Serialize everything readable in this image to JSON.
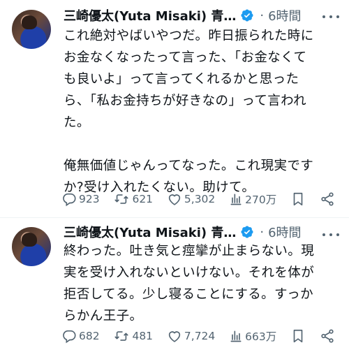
{
  "tweets": [
    {
      "author": "三崎優太(Yuta Misaki) 青…",
      "time": "6時間",
      "text": "これ絶対やばいやつだ。昨日振られた時に\nお金なくなったって言った、「お金なくて\nも良いよ」って言ってくれるかと思った\nら、「私お金持ちが好きなの」って言われ\nた。\n\n俺無価値じゃんってなった。これ現実です\nか?受け入れたくない。助けて。",
      "replies": "923",
      "retweets": "621",
      "likes": "5,302",
      "views": "270万"
    },
    {
      "author": "三崎優太(Yuta Misaki) 青…",
      "time": "6時間",
      "text": "終わった。吐き気と痙攣が止まらない。現\n実を受け入れないといけない。それを体が\n拒否してる。少し寝ることにする。すっか\nらかん王子。",
      "replies": "682",
      "retweets": "481",
      "likes": "7,724",
      "views": "663万"
    }
  ],
  "separator": "·",
  "colors": {
    "text": "#0f1419",
    "muted": "#536471",
    "verified": "#1d9bf0",
    "divider": "#eff3f4"
  },
  "icons": [
    "verified-badge-icon",
    "more-icon",
    "reply-icon",
    "retweet-icon",
    "like-icon",
    "views-icon",
    "bookmark-icon",
    "share-icon"
  ]
}
